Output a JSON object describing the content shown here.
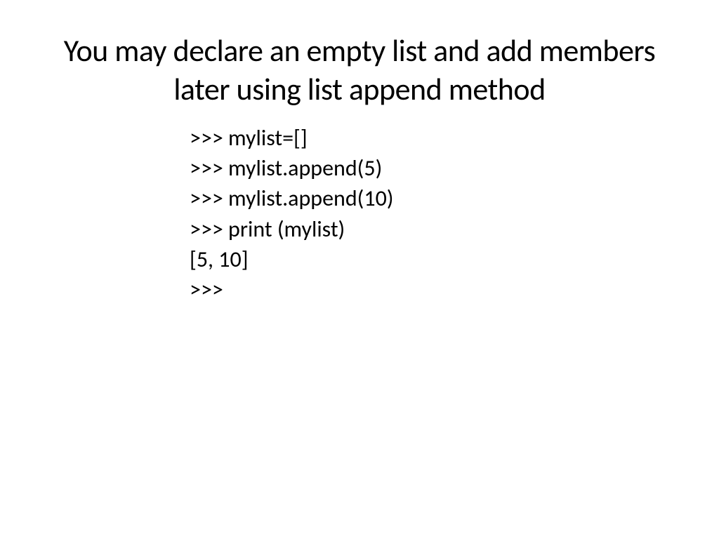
{
  "slide": {
    "title": "You may declare an empty list and add members later using list append method",
    "code": {
      "line1": ">>> mylist=[]",
      "line2": ">>> mylist.append(5)",
      "line3": ">>> mylist.append(10)",
      "line4": ">>> print (mylist)",
      "line5": "[5, 10]",
      "line6": ">>>"
    }
  }
}
